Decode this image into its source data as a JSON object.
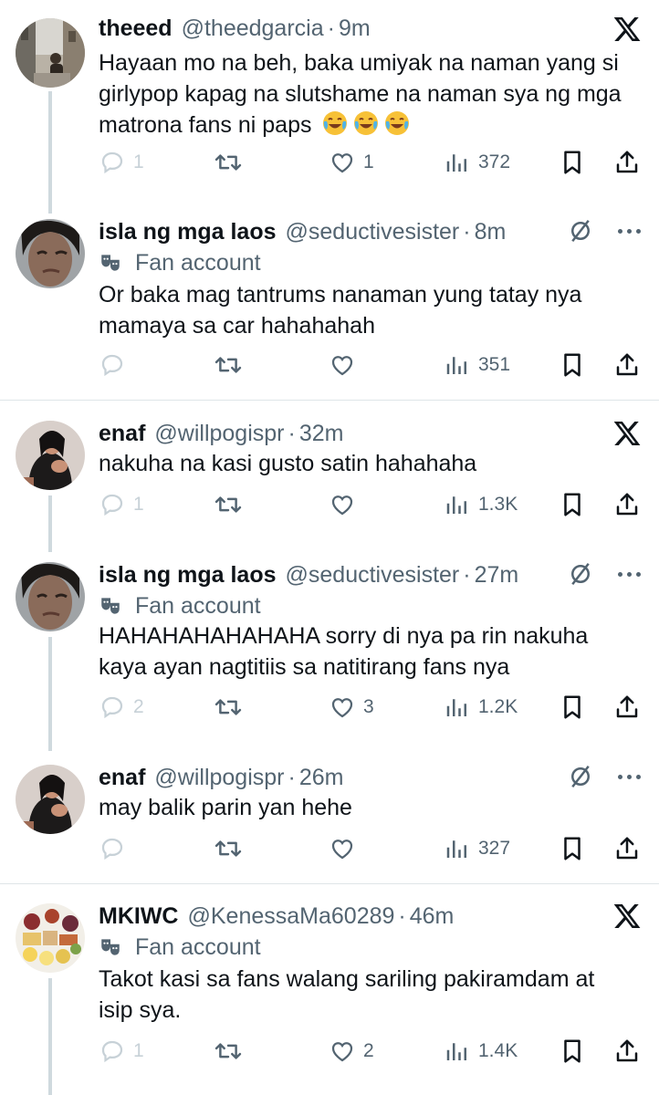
{
  "tweets": [
    {
      "name": "theeed",
      "handle": "@theedgarcia",
      "sep": "·",
      "time": "9m",
      "badge": "",
      "text": "Hayaan mo na beh, baka umiyak na naman yang si girlypop kapag na slutshame na naman sya ng mga matrona fans ni paps",
      "emojis": [
        "face-with-tears-of-joy",
        "face-with-tears-of-joy",
        "face-with-tears-of-joy"
      ],
      "replies": "1",
      "likes": "1",
      "views": "372",
      "top_icon": "x-logo"
    },
    {
      "name": "isla ng mga laos",
      "handle": "@seductivesister",
      "sep": "·",
      "time": "8m",
      "badge": "Fan account",
      "text": "Or baka mag tantrums nanaman yung tatay nya mamaya sa car hahahahah",
      "replies": "",
      "likes": "",
      "views": "351",
      "top_icon": "grok-icon"
    },
    {
      "name": "enaf",
      "handle": "@willpogispr",
      "sep": "·",
      "time": "32m",
      "badge": "",
      "text": "nakuha na kasi gusto satin hahahaha",
      "replies": "1",
      "likes": "",
      "views": "1.3K",
      "top_icon": "x-logo"
    },
    {
      "name": "isla ng mga laos",
      "handle": "@seductivesister",
      "sep": "·",
      "time": "27m",
      "badge": "Fan account",
      "text": "HAHAHAHAHAHAHA sorry di nya pa rin nakuha kaya ayan nagtitiis sa natitirang fans nya",
      "replies": "2",
      "likes": "3",
      "views": "1.2K",
      "top_icon": "grok-icon"
    },
    {
      "name": "enaf",
      "handle": "@willpogispr",
      "sep": "·",
      "time": "26m",
      "badge": "",
      "text": "may balik parin yan hehe",
      "replies": "",
      "likes": "",
      "views": "327",
      "top_icon": "grok-icon"
    },
    {
      "name": "MKIWC",
      "handle": "@KenessaMa60289",
      "sep": "·",
      "time": "46m",
      "badge": "Fan account",
      "text": "Takot kasi sa fans walang sariling pakiramdam at isip sya.",
      "replies": "1",
      "likes": "2",
      "views": "1.4K",
      "top_icon": "x-logo"
    }
  ],
  "colors": {
    "text": "#0f1419",
    "muted": "#536471",
    "faded": "#c7d1d7",
    "line": "#cfd9de"
  }
}
